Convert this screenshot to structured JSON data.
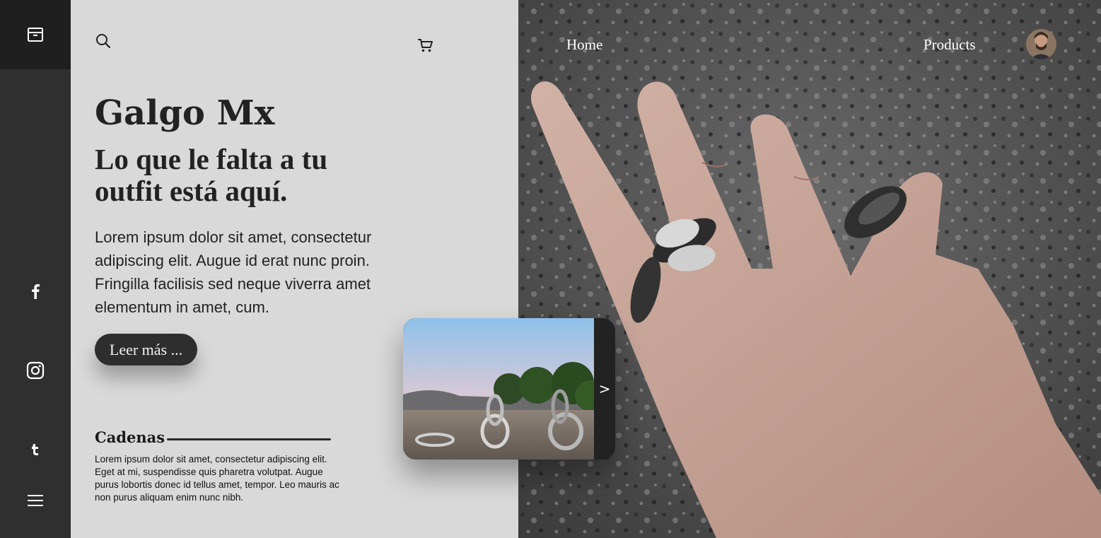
{
  "brand": {
    "title": "Galgo Mx",
    "tagline": "Lo que le falta a tu outfit está aquí.",
    "intro": "Lorem ipsum dolor sit amet, consectetur adipiscing elit. Augue id erat nunc proin. Fringilla facilisis sed neque viverra amet elementum in amet, cum."
  },
  "cta": {
    "label": "Leer más ..."
  },
  "section": {
    "title": "Cadenas",
    "text": "Lorem ipsum dolor sit amet, consectetur adipiscing elit. Eget at mi, suspendisse quis pharetra volutpat. Augue purus lobortis donec id tellus amet, tempor. Leo mauris ac non purus aliquam enim nunc nibh."
  },
  "nav": {
    "home": "Home",
    "products": "Products"
  },
  "card": {
    "next_label": ">"
  },
  "icons": {
    "sidebar_top": "archive-icon",
    "facebook": "facebook-icon",
    "instagram": "instagram-icon",
    "tumblr": "tumblr-icon",
    "menu": "menu-icon",
    "search": "search-icon",
    "cart": "cart-icon"
  },
  "colors": {
    "sidebar": "#2f2f2f",
    "sidebar_top": "#1f1f1f",
    "panel_bg": "#d9d9d9",
    "button_bg": "#2e2e2e",
    "text_dark": "#222222"
  }
}
